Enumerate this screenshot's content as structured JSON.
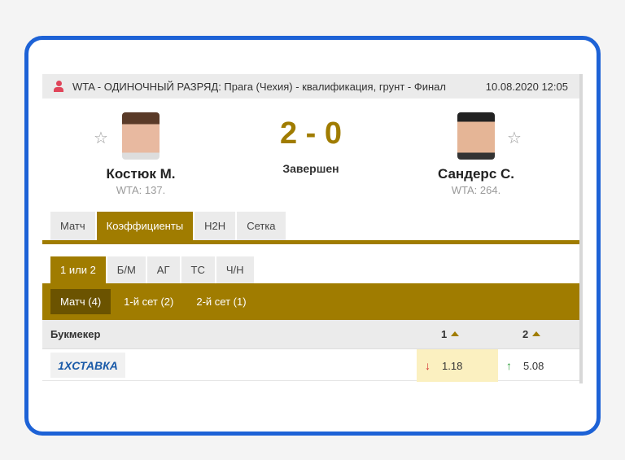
{
  "header": {
    "title": "WTA - ОДИНОЧНЫЙ РАЗРЯД: Прага (Чехия) - квалификация, грунт - Финал",
    "datetime": "10.08.2020 12:05"
  },
  "player1": {
    "name": "Костюк М.",
    "rank": "WTA: 137."
  },
  "player2": {
    "name": "Сандерс С.",
    "rank": "WTA: 264."
  },
  "score": "2 - 0",
  "status": "Завершен",
  "tabs": [
    "Матч",
    "Коэффициенты",
    "H2H",
    "Сетка"
  ],
  "subtabs": [
    "1 или 2",
    "Б/М",
    "АГ",
    "ТС",
    "Ч/Н"
  ],
  "periods": [
    "Матч (4)",
    "1-й сет (2)",
    "2-й сет (1)"
  ],
  "table": {
    "col_bookmaker": "Букмекер",
    "col1": "1",
    "col2": "2",
    "rows": [
      {
        "bookmaker": "1XСТАВКА",
        "odd1": "1.18",
        "odd1_trend": "down",
        "odd2": "5.08",
        "odd2_trend": "up"
      }
    ]
  },
  "colors": {
    "accent": "#a07c00",
    "frame": "#1d62d6",
    "down": "#d32f2f",
    "up": "#2e9e3a"
  }
}
